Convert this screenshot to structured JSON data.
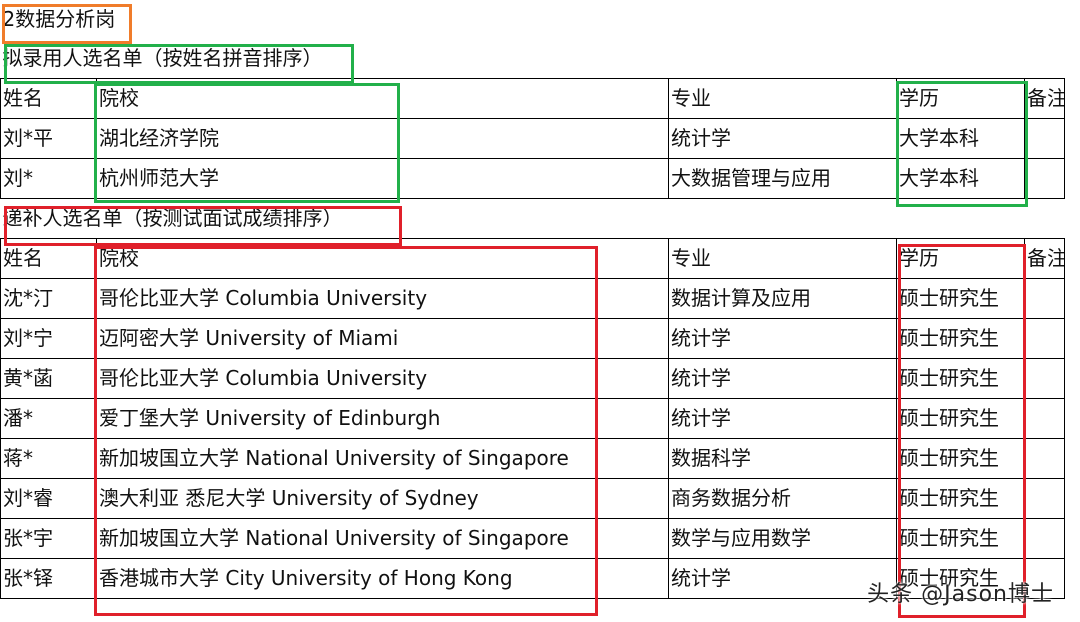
{
  "section_title": "2数据分析岗",
  "list1_title": "拟录用人选名单（按姓名拼音排序）",
  "list2_title": "递补人选名单（按测试面试成绩排序）",
  "headers": [
    "姓名",
    "院校",
    "专业",
    "学历",
    "备注"
  ],
  "list1_rows": [
    [
      "刘*平",
      "湖北经济学院",
      "统计学",
      "大学本科",
      ""
    ],
    [
      "刘*",
      "杭州师范大学",
      "大数据管理与应用",
      "大学本科",
      ""
    ]
  ],
  "list2_rows": [
    [
      "沈*汀",
      "哥伦比亚大学 Columbia University",
      "数据计算及应用",
      "硕士研究生",
      ""
    ],
    [
      "刘*宁",
      "迈阿密大学 University of Miami",
      "统计学",
      "硕士研究生",
      ""
    ],
    [
      "黄*菡",
      "哥伦比亚大学 Columbia University",
      "统计学",
      "硕士研究生",
      ""
    ],
    [
      "潘*",
      "爱丁堡大学 University of Edinburgh",
      "统计学",
      "硕士研究生",
      ""
    ],
    [
      "蒋*",
      "新加坡国立大学 National University of Singapore",
      "数据科学",
      "硕士研究生",
      ""
    ],
    [
      "刘*睿",
      "澳大利亚 悉尼大学 University of Sydney",
      "商务数据分析",
      "硕士研究生",
      ""
    ],
    [
      "张*宇",
      "新加坡国立大学 National University of Singapore",
      "数学与应用数学",
      "硕士研究生",
      ""
    ],
    [
      "张*铎",
      "香港城市大学 City University of Hong Kong",
      "统计学",
      "硕士研究生",
      ""
    ]
  ],
  "watermark": "头条 @Jason博士",
  "colors": {
    "orange": "#f07c2a",
    "green": "#22b04a",
    "red": "#e0202a"
  }
}
